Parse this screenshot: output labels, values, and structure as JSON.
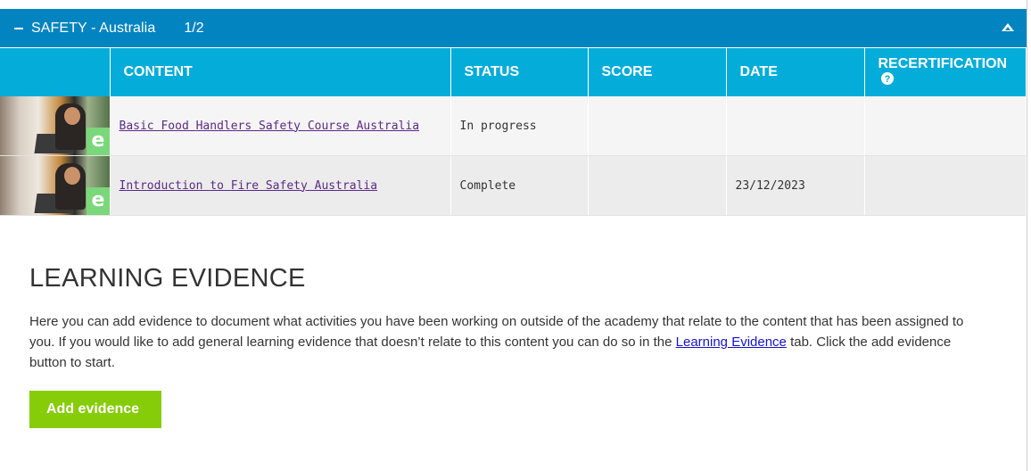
{
  "section": {
    "title": "SAFETY - Australia",
    "count": "1/2"
  },
  "table": {
    "headers": [
      "CONTENT",
      "STATUS",
      "SCORE",
      "DATE",
      "RECERTIFICATION"
    ],
    "recert_help_icon": "question-circle-icon",
    "rows": [
      {
        "content": "Basic Food Handlers Safety Course Australia",
        "status": "In progress",
        "score": "",
        "date": "",
        "recertification": ""
      },
      {
        "content": "Introduction to Fire Safety Australia",
        "status": "Complete",
        "score": "",
        "date": "23/12/2023",
        "recertification": ""
      }
    ],
    "badge_glyph": "e"
  },
  "evidence": {
    "heading": "LEARNING EVIDENCE",
    "text_before": "Here you can add evidence to document what activities you have been working on outside of the academy that relate to the content that has been assigned to you. If you would like to add general learning evidence that doesn’t relate to this content you can do so in the ",
    "link_text": "Learning Evidence",
    "text_after": " tab. Click the add evidence button to start.",
    "button_label": "Add evidence"
  },
  "colors": {
    "header_bar": "#0284c1",
    "table_header": "#03acd9",
    "button": "#86cc08",
    "link_visited": "#5b2a86"
  }
}
